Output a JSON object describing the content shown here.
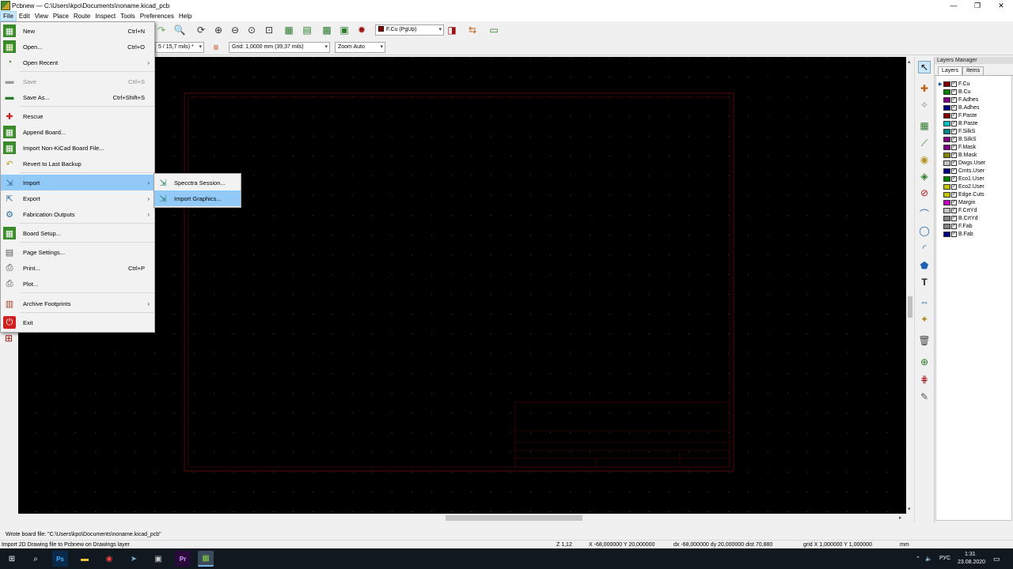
{
  "window": {
    "title": "Pcbnew — C:\\Users\\kpo\\Documents\\noname.kicad_pcb",
    "minimize": "—",
    "maximize": "❐",
    "close": "✕"
  },
  "menubar": {
    "items": [
      "File",
      "Edit",
      "View",
      "Place",
      "Route",
      "Inspect",
      "Tools",
      "Preferences",
      "Help"
    ],
    "active": "File"
  },
  "toolbar": {
    "layer_combo": "F.Cu (PgUp)",
    "track_width_combo": "5 / 15,7 mils) *",
    "grid_combo": "Grid: 1,0000 mm (39,37 mils)",
    "zoom_combo": "Zoom Auto",
    "colors": {
      "layer_swatch": "#840000"
    }
  },
  "file_menu": {
    "items": [
      {
        "label": "New",
        "shortcut": "Ctrl+N",
        "icon": "new-board-icon"
      },
      {
        "label": "Open...",
        "shortcut": "Ctrl+O",
        "icon": "open-board-icon"
      },
      {
        "label": "Open Recent",
        "submenu": true,
        "icon": "open-recent-icon"
      },
      {
        "label": "Save",
        "shortcut": "Ctrl+S",
        "disabled": true,
        "icon": "save-icon"
      },
      {
        "label": "Save As...",
        "shortcut": "Ctrl+Shift+S",
        "icon": "save-as-icon"
      },
      {
        "label": "Rescue",
        "icon": "rescue-icon"
      },
      {
        "label": "Append Board...",
        "icon": "append-board-icon"
      },
      {
        "label": "Import Non-KiCad Board File...",
        "icon": "import-board-icon"
      },
      {
        "label": "Revert to Last Backup",
        "icon": "revert-icon"
      },
      {
        "label": "Import",
        "submenu": true,
        "highlighted": true,
        "icon": "import-icon"
      },
      {
        "label": "Export",
        "submenu": true,
        "icon": "export-icon"
      },
      {
        "label": "Fabrication Outputs",
        "submenu": true,
        "icon": "fabrication-icon"
      },
      {
        "label": "Board Setup...",
        "icon": "board-setup-icon"
      },
      {
        "label": "Page Settings...",
        "icon": "page-settings-icon"
      },
      {
        "label": "Print...",
        "shortcut": "Ctrl+P",
        "icon": "print-icon"
      },
      {
        "label": "Plot...",
        "icon": "plot-icon"
      },
      {
        "label": "Archive Footprints",
        "submenu": true,
        "icon": "archive-icon"
      },
      {
        "label": "Exit",
        "icon": "exit-icon"
      }
    ]
  },
  "import_submenu": {
    "items": [
      {
        "label": "Specctra Session..."
      },
      {
        "label": "Import Graphics...",
        "highlighted": true
      }
    ]
  },
  "layers_manager": {
    "title": "Layers Manager",
    "tabs": [
      "Layers",
      "Items"
    ],
    "active_tab": "Layers",
    "layers": [
      {
        "name": "F.Cu",
        "color": "#840000"
      },
      {
        "name": "B.Cu",
        "color": "#008400"
      },
      {
        "name": "F.Adhes",
        "color": "#840084"
      },
      {
        "name": "B.Adhes",
        "color": "#000084"
      },
      {
        "name": "F.Paste",
        "color": "#840000"
      },
      {
        "name": "B.Paste",
        "color": "#00c2c2"
      },
      {
        "name": "F.SilkS",
        "color": "#008484"
      },
      {
        "name": "B.SilkS",
        "color": "#840084"
      },
      {
        "name": "F.Mask",
        "color": "#840084"
      },
      {
        "name": "B.Mask",
        "color": "#848400"
      },
      {
        "name": "Dwgs.User",
        "color": "#c2c2c2"
      },
      {
        "name": "Cmts.User",
        "color": "#000084"
      },
      {
        "name": "Eco1.User",
        "color": "#008400"
      },
      {
        "name": "Eco2.User",
        "color": "#c2c200"
      },
      {
        "name": "Edge.Cuts",
        "color": "#c2c200"
      },
      {
        "name": "Margin",
        "color": "#c200c2"
      },
      {
        "name": "F.CrtYd",
        "color": "#c2c2c2"
      },
      {
        "name": "B.CrtYd",
        "color": "#848484"
      },
      {
        "name": "F.Fab",
        "color": "#848484"
      },
      {
        "name": "B.Fab",
        "color": "#000084"
      }
    ]
  },
  "status": {
    "message": "Wrote board file: \"C:\\Users\\kpo\\Documents\\noname.kicad_pcb\"",
    "hint": "Import 2D Drawing file to Pcbnew on Drawings layer",
    "zoom": "Z 1,12",
    "abs_coords": "X -68,000000  Y 20,000000",
    "rel_coords": "dx -68,000000  dy 20,000000  dist 70,880",
    "grid": "grid X 1,000000  Y 1,000000",
    "units": "mm"
  },
  "taskbar": {
    "language": "РУС",
    "time": "1:31",
    "date": "23.08.2020"
  }
}
